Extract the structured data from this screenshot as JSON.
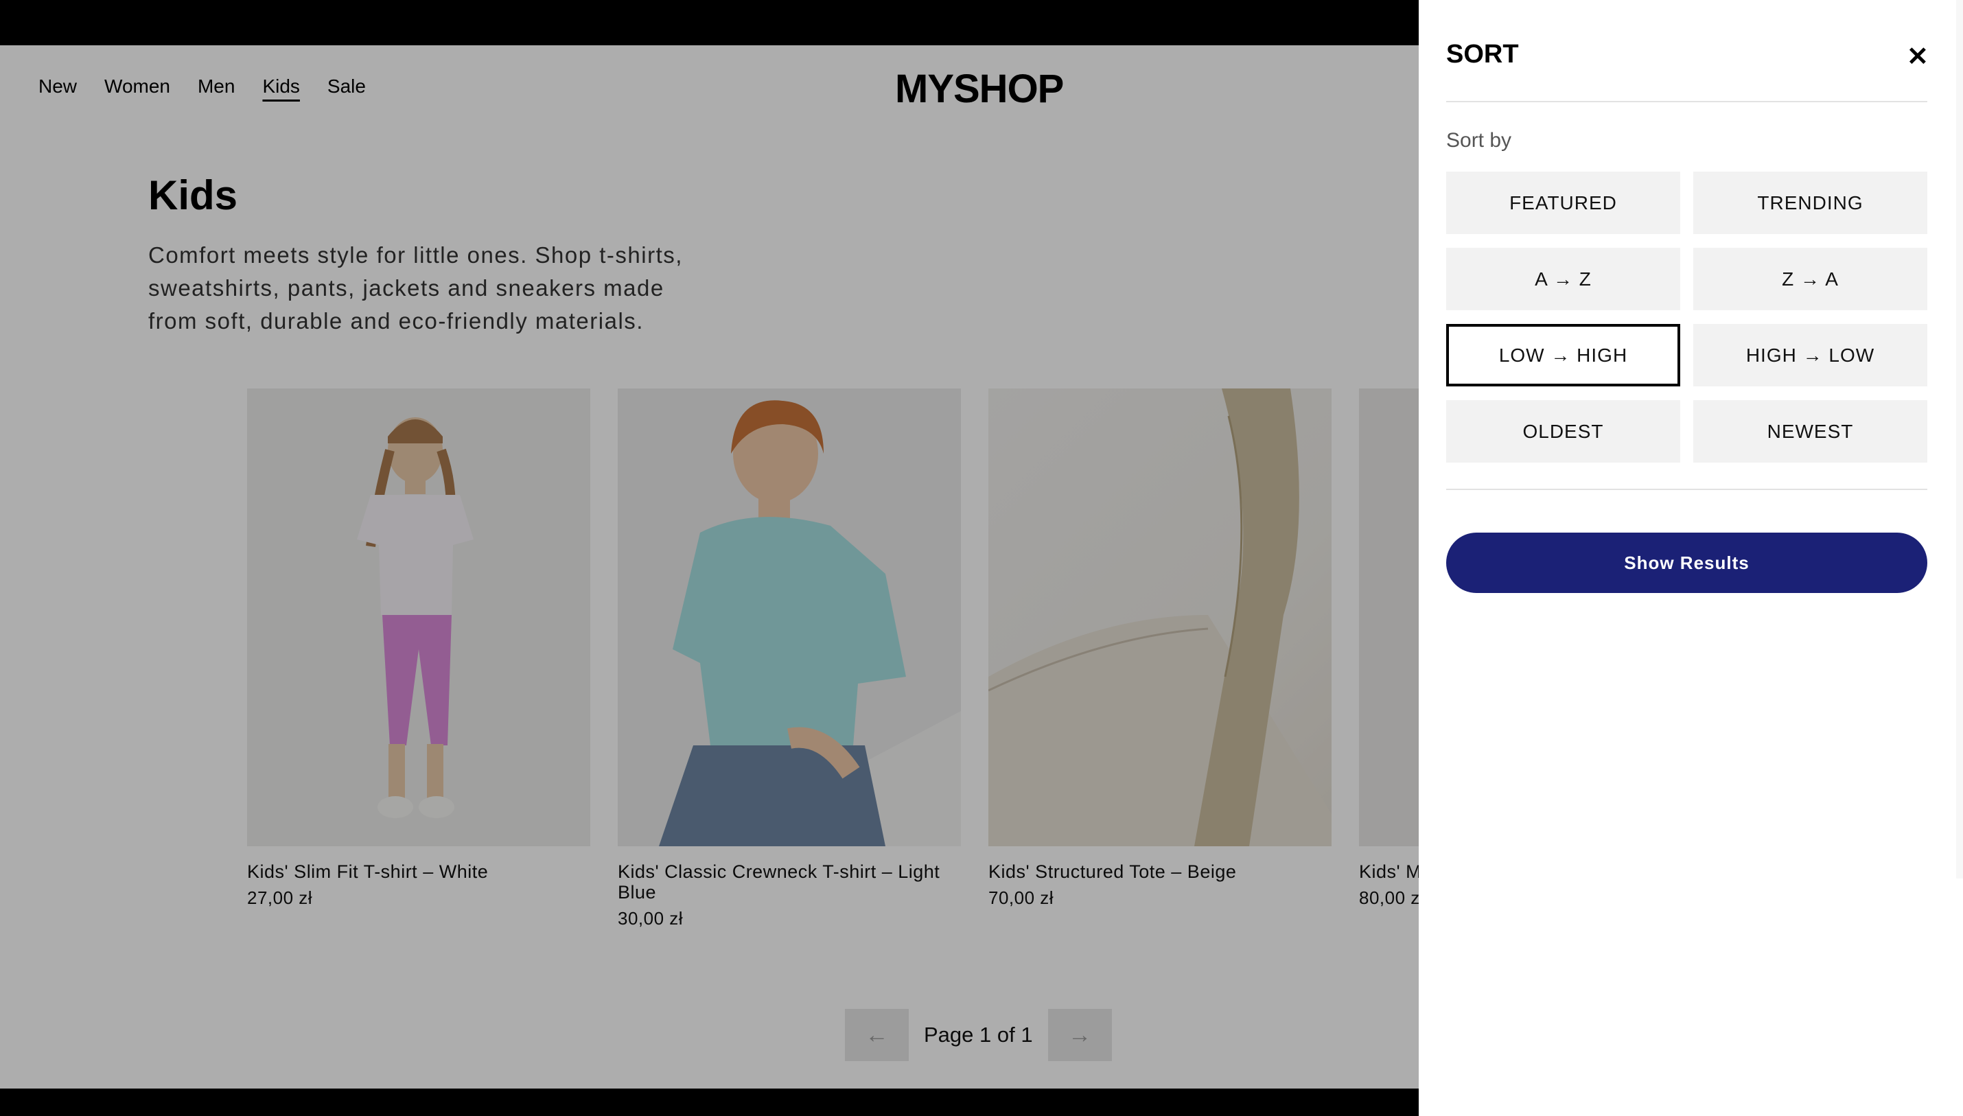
{
  "nav": {
    "items": [
      "New",
      "Women",
      "Men",
      "Kids",
      "Sale"
    ],
    "active": "Kids"
  },
  "logo": "MYSHOP",
  "category": {
    "title": "Kids",
    "description": "Comfort meets style for little ones. Shop t-shirts, sweatshirts, pants, jackets and sneakers made from soft, durable and eco-friendly materials."
  },
  "products": [
    {
      "name": "Kids' Slim Fit T-shirt – White",
      "price": "27,00 zł"
    },
    {
      "name": "Kids' Classic Crewneck T-shirt – Light Blue",
      "price": "30,00 zł"
    },
    {
      "name": "Kids' Structured Tote – Beige",
      "price": "70,00 zł"
    },
    {
      "name": "Kids' M",
      "price": "80,00 z"
    }
  ],
  "pagination": {
    "prev_icon": "←",
    "next_icon": "→",
    "label": "Page 1 of 1"
  },
  "sort_panel": {
    "title": "SORT",
    "close_icon": "✕",
    "sort_by_label": "Sort by",
    "options": [
      "FEATURED",
      "TRENDING",
      "A → Z",
      "Z → A",
      "LOW → HIGH",
      "HIGH → LOW",
      "OLDEST",
      "NEWEST"
    ],
    "selected": "LOW → HIGH",
    "show_results": "Show Results"
  },
  "colors": {
    "accent": "#1b2176",
    "overlay": "rgba(0,0,0,0.32)"
  }
}
